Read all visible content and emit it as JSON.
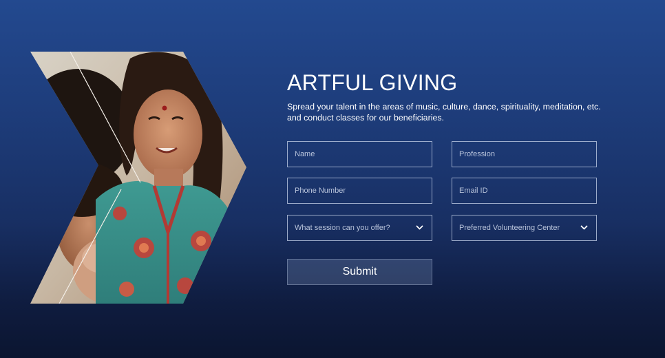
{
  "title": "ARTFUL GIVING",
  "subtitle": "Spread your talent in the areas of music, culture, dance, spirituality, meditation, etc. and conduct classes for our beneficiaries.",
  "form": {
    "name": {
      "placeholder": "Name",
      "value": ""
    },
    "profession": {
      "placeholder": "Profession",
      "value": ""
    },
    "phone": {
      "placeholder": "Phone Number",
      "value": ""
    },
    "email": {
      "placeholder": "Email ID",
      "value": ""
    },
    "session": {
      "selected": "What session can you offer?"
    },
    "center": {
      "selected": "Preferred Volunteering Center"
    },
    "submit_label": "Submit"
  },
  "icons": {
    "dropdown": "chevron-down-icon"
  },
  "colors": {
    "background_top": "#23498f",
    "background_bottom": "#0b1530",
    "text": "#ffffff",
    "placeholder": "#b9c4db",
    "field_border": "#c8d4eb"
  }
}
